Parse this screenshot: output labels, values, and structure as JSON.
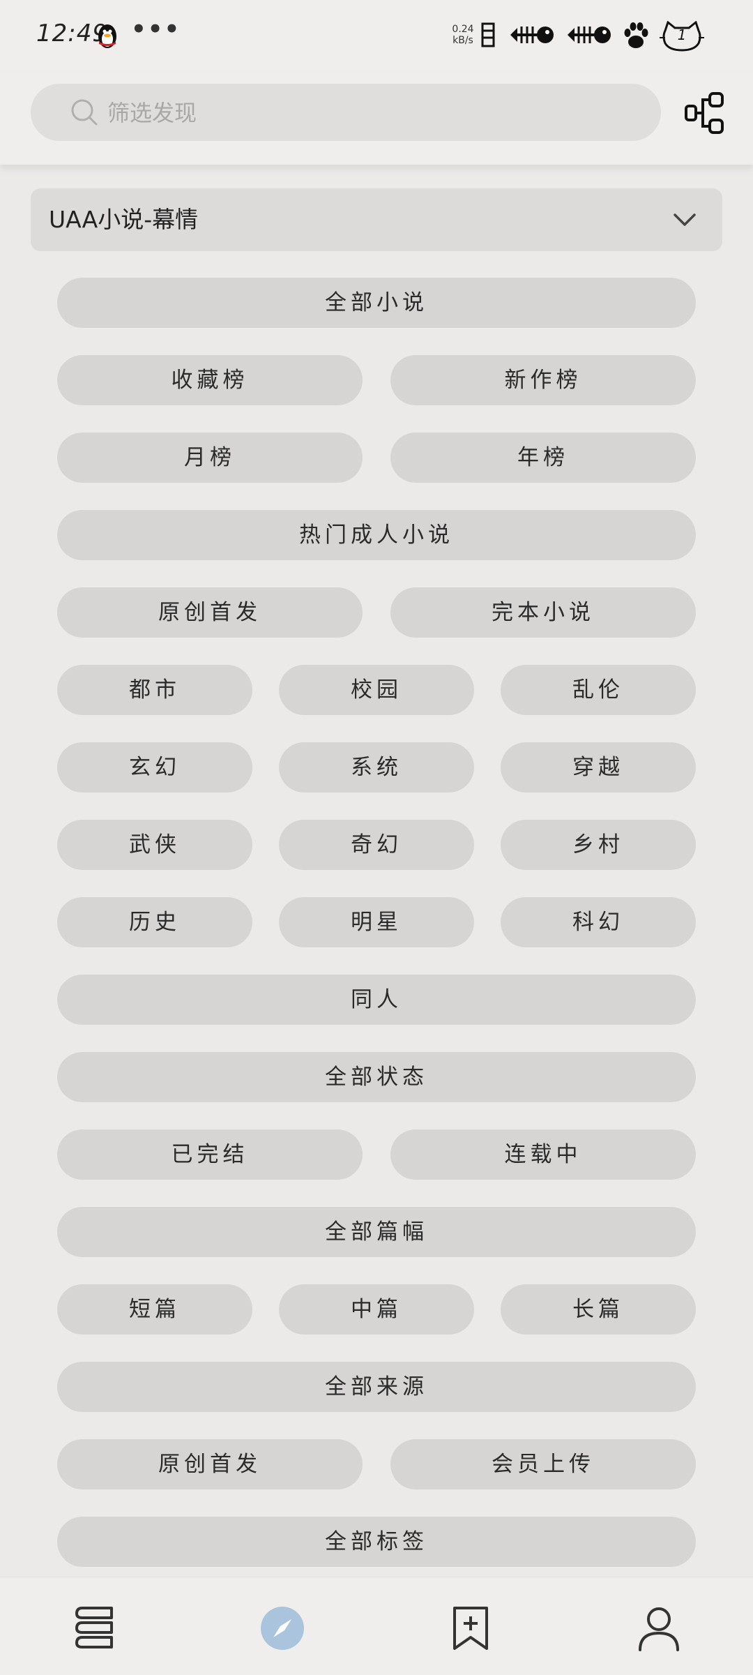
{
  "status_bar": {
    "time": "12:49",
    "more": "•••",
    "net_speed_value": "0.24",
    "net_speed_unit": "kB/s",
    "battery_level": "1"
  },
  "search": {
    "placeholder": "筛选发现"
  },
  "source_selector": {
    "label": "UAA小说-幕情"
  },
  "chips": {
    "all_novels": "全部小说",
    "favorites_rank": "收藏榜",
    "new_works_rank": "新作榜",
    "monthly_rank": "月榜",
    "yearly_rank": "年榜",
    "hot_adult": "热门成人小说",
    "original_first": "原创首发",
    "completed": "完本小说",
    "urban": "都市",
    "campus": "校园",
    "genre_luanlun": "乱伦",
    "xuanhuan": "玄幻",
    "system": "系统",
    "time_travel": "穿越",
    "wuxia": "武侠",
    "fantasy": "奇幻",
    "village": "乡村",
    "history": "历史",
    "celebrity": "明星",
    "scifi": "科幻",
    "fanfic": "同人",
    "all_status": "全部状态",
    "finished": "已完结",
    "ongoing": "连载中",
    "all_length": "全部篇幅",
    "short": "短篇",
    "medium": "中篇",
    "long": "长篇",
    "all_source": "全部来源",
    "source_original": "原创首发",
    "member_upload": "会员上传",
    "all_tags": "全部标签"
  },
  "colors": {
    "background": "#ebeae9",
    "chip": "#d6d5d4",
    "active_nav": "#a9c4dc"
  },
  "nav": {
    "bookshelf_icon": "books-icon",
    "discover_icon": "compass-icon",
    "rss_icon": "bookmark-add-icon",
    "profile_icon": "person-icon"
  }
}
